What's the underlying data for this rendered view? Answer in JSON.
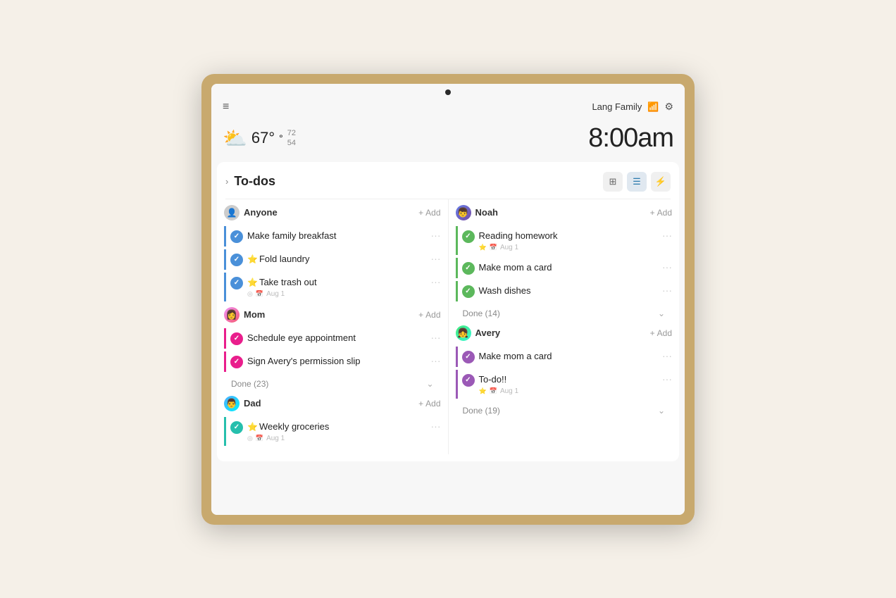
{
  "frame": {
    "camera_alt": "camera"
  },
  "topbar": {
    "menu_icon": "≡",
    "family_name": "Lang Family",
    "wifi_icon": "📶",
    "settings_icon": "⚙"
  },
  "header": {
    "weather_icon": "⛅",
    "temp": "67°",
    "high": "72",
    "low": "54",
    "time": "8:00am"
  },
  "todos": {
    "title": "To-dos",
    "columns": [
      {
        "id": "anyone",
        "user": "Anyone",
        "avatar_type": "anyone",
        "add_label": "Add",
        "tasks": [
          {
            "id": 1,
            "label": "Make family breakfast",
            "checked": true,
            "border": "blue-border",
            "has_emoji": false
          },
          {
            "id": 2,
            "label": "Fold laundry",
            "checked": true,
            "border": "blue-border",
            "has_emoji": true,
            "emoji": "⭐"
          },
          {
            "id": 3,
            "label": "Take trash out",
            "checked": true,
            "border": "blue-border",
            "has_emoji": true,
            "emoji": "⭐",
            "has_date": true,
            "date": "Aug 1"
          }
        ],
        "section_mom": {
          "user": "Mom",
          "avatar_type": "mom",
          "add_label": "Add",
          "tasks": [
            {
              "id": 4,
              "label": "Schedule eye appointment",
              "checked": true,
              "border": "pink-border"
            },
            {
              "id": 5,
              "label": "Sign Avery's permission slip",
              "checked": true,
              "border": "pink-border"
            }
          ],
          "done_count": "Done (23)"
        },
        "section_dad": {
          "user": "Dad",
          "avatar_type": "dad",
          "add_label": "Add",
          "tasks": [
            {
              "id": 6,
              "label": "Weekly groceries",
              "checked": true,
              "border": "teal-border",
              "has_emoji": true,
              "emoji": "⭐",
              "has_date": true,
              "date": "Aug 1"
            }
          ]
        }
      },
      {
        "id": "noah",
        "user": "Noah",
        "avatar_type": "noah",
        "add_label": "Add",
        "tasks": [
          {
            "id": 7,
            "label": "Reading homework",
            "checked": true,
            "border": "green-border",
            "has_emoji": true,
            "emoji": "⭐",
            "has_date": true,
            "date": "Aug 1"
          },
          {
            "id": 8,
            "label": "Make mom a card",
            "checked": true,
            "border": "green-border"
          },
          {
            "id": 9,
            "label": "Wash dishes",
            "checked": true,
            "border": "green-border"
          }
        ],
        "done_count": "Done (14)",
        "section_avery": {
          "user": "Avery",
          "avatar_type": "avery",
          "add_label": "Add",
          "tasks": [
            {
              "id": 10,
              "label": "Make mom a card",
              "checked": true,
              "border": "purple-border"
            },
            {
              "id": 11,
              "label": "To-do!!",
              "checked": true,
              "border": "purple-border",
              "has_emoji": true,
              "emoji": "⭐",
              "has_date": true,
              "date": "Aug 1"
            }
          ],
          "done_count": "Done (19)"
        }
      }
    ]
  }
}
